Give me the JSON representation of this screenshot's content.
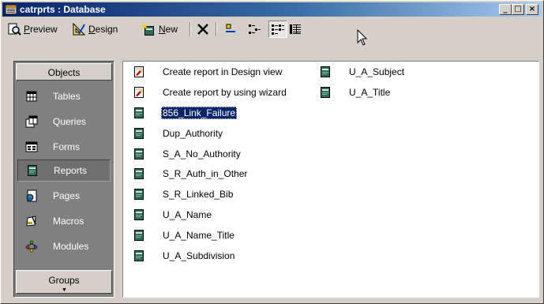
{
  "window": {
    "title": "catrprts : Database",
    "icon": "database-window-icon",
    "controls": [
      "_",
      "□",
      "×"
    ]
  },
  "toolbar": {
    "preview": {
      "label_first": "P",
      "label_rest": "review",
      "icon": "preview-icon"
    },
    "design": {
      "label_first": "D",
      "label_rest": "esign",
      "icon": "design-icon"
    },
    "new": {
      "label_first": "N",
      "label_rest": "ew",
      "icon": "new-icon"
    },
    "delete_icon": "delete-icon",
    "view_icons": [
      "large-icons-view-icon",
      "small-icons-view-icon",
      "list-view-icon",
      "details-view-icon"
    ],
    "active_view": "list"
  },
  "objects_bar": {
    "header": "Objects",
    "items": [
      {
        "label": "Tables",
        "icon": "tables-icon"
      },
      {
        "label": "Queries",
        "icon": "queries-icon"
      },
      {
        "label": "Forms",
        "icon": "forms-icon"
      },
      {
        "label": "Reports",
        "icon": "reports-icon"
      },
      {
        "label": "Pages",
        "icon": "pages-icon"
      },
      {
        "label": "Macros",
        "icon": "macros-icon"
      },
      {
        "label": "Modules",
        "icon": "modules-icon"
      }
    ],
    "selected": "Reports",
    "groups_label": "Groups",
    "groups_arrow": "▼"
  },
  "report_list": {
    "shortcuts": [
      {
        "label": "Create report in Design view",
        "icon": "create-shortcut-icon"
      },
      {
        "label": "Create report by using wizard",
        "icon": "wizard-shortcut-icon"
      }
    ],
    "reports": [
      "856_Link_Failure",
      "Dup_Authority",
      "S_A_No_Authority",
      "S_R_Auth_in_Other",
      "S_R_Linked_Bib",
      "U_A_Name",
      "U_A_Name_Title",
      "U_A_Subdivision",
      "U_A_Subject",
      "U_A_Title"
    ],
    "selected": "856_Link_Failure"
  },
  "colors": {
    "title_bar_start": "#0a246a",
    "title_bar_end": "#a6caf0",
    "selection": "#0a246a",
    "report_icon": "#2f6b55",
    "chrome": "#d4d0c8",
    "objects_bar": "#808080"
  }
}
